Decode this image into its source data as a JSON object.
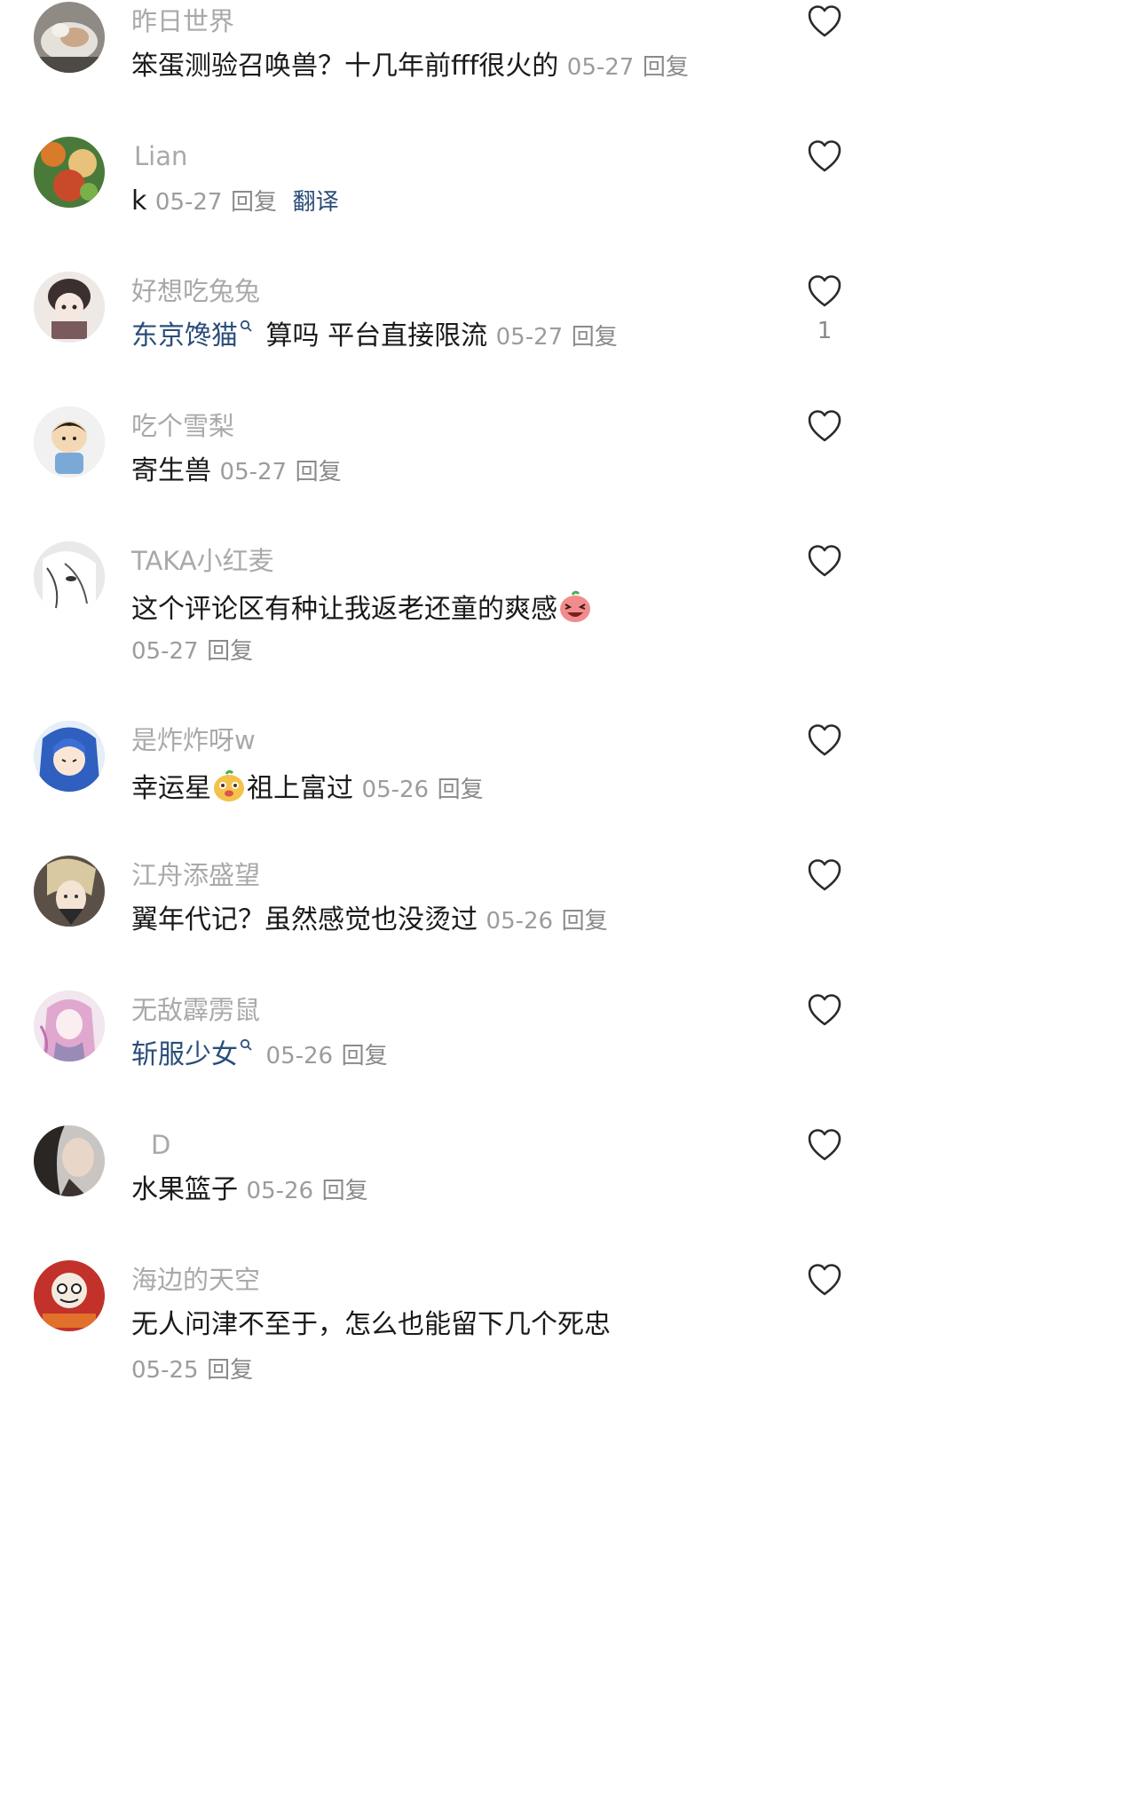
{
  "comments": [
    {
      "username": "昨日世界",
      "text": "笨蛋测验召唤兽？十几年前fff很火的",
      "date": "05-27",
      "reply": "回复",
      "avatar": "avatar-sleeping-cat"
    },
    {
      "username": "Lian",
      "text": "k",
      "date": "05-27",
      "reply": "回复",
      "translate": "翻译",
      "avatar": "avatar-flower-boy"
    },
    {
      "username": "好想吃兔兔",
      "mention": "东京馋猫",
      "text": "算吗 平台直接限流",
      "date": "05-27",
      "reply": "回复",
      "likes": "1",
      "avatar": "avatar-bunny-girl"
    },
    {
      "username": "吃个雪梨",
      "text": "寄生兽",
      "date": "05-27",
      "reply": "回复",
      "avatar": "avatar-cartoon-kid"
    },
    {
      "username": "TAKA小红麦",
      "text": "这个评论区有种让我返老还童的爽感",
      "date": "05-27",
      "reply": "回复",
      "emoji": "laughing-face-emoji",
      "avatar": "avatar-sketch-face"
    },
    {
      "username": "是炸炸呀w",
      "text_before": "幸运星",
      "text_after": "祖上富过",
      "date": "05-26",
      "reply": "回复",
      "emoji": "dog-face-emoji",
      "avatar": "avatar-blue-hair"
    },
    {
      "username": "江舟添盛望",
      "text": "翼年代记？虽然感觉也没烫过",
      "date": "05-26",
      "reply": "回复",
      "avatar": "avatar-anime-man"
    },
    {
      "username": "无敌霹雳鼠",
      "mention": "斩服少女",
      "text": "",
      "date": "05-26",
      "reply": "回复",
      "avatar": "avatar-pink-girl"
    },
    {
      "username": "D",
      "text": "水果篮子",
      "date": "05-26",
      "reply": "回复",
      "avatar": "avatar-portrait"
    },
    {
      "username": "海边的天空",
      "text": "无人问津不至于，怎么也能留下几个死忠",
      "date": "05-25",
      "reply": "回复",
      "avatar": "avatar-daruma"
    }
  ],
  "colors": {
    "username": "#a9a9a9",
    "text": "#1a1a1a",
    "mention": "#2b4e7a",
    "meta": "#9c9c9c"
  },
  "icons": {
    "like": "heart-outline-icon"
  }
}
